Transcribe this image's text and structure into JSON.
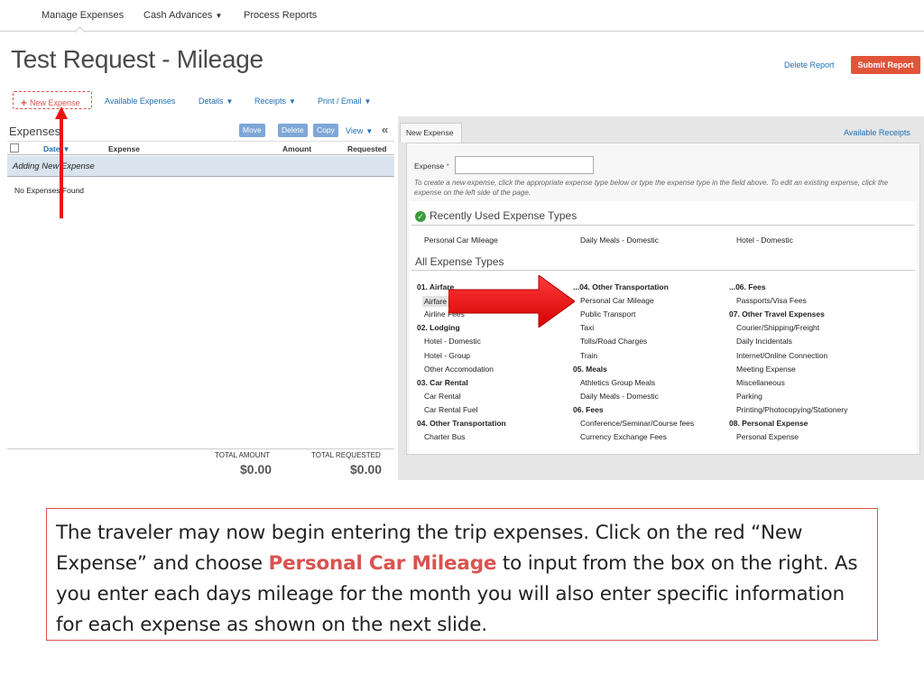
{
  "nav": {
    "items": [
      "Manage Expenses",
      "Cash Advances",
      "Process Reports"
    ],
    "caret": "▼"
  },
  "header": {
    "title": "Test Request - Mileage",
    "delete_report": "Delete Report",
    "submit_report": "Submit Report"
  },
  "toolbar": {
    "new_expense": "New Expense",
    "available_expenses": "Available Expenses",
    "details": "Details",
    "receipts": "Receipts",
    "print_email": "Print / Email"
  },
  "left": {
    "heading": "Expenses",
    "buttons": [
      "Move",
      "Delete",
      "Copy"
    ],
    "view": "View",
    "collapse_icon": "«",
    "columns": [
      "Date",
      "Expense",
      "Amount",
      "Requested"
    ],
    "adding_row": "Adding New Expense",
    "no_expenses": "No Expenses Found",
    "total_amount_label": "TOTAL AMOUNT",
    "total_amount": "$0.00",
    "total_requested_label": "TOTAL REQUESTED",
    "total_requested": "$0.00"
  },
  "right": {
    "tab": "New Expense",
    "available_receipts": "Available Receipts",
    "expense_label": "Expense",
    "required_mark": "*",
    "expense_value": "",
    "help_text": "To create a new expense, click the appropriate expense type below or type the expense type in the field above. To edit an existing expense, click the expense on the left side of the page.",
    "recent_title": "Recently Used Expense Types",
    "recent": [
      "Personal Car Mileage",
      "Daily Meals - Domestic",
      "Hotel - Domestic"
    ],
    "all_title": "All Expense Types",
    "col1": [
      {
        "type": "cat",
        "text": "01. Airfare"
      },
      {
        "type": "item",
        "text": "Airfare",
        "hl": true
      },
      {
        "type": "item",
        "text": "Airline Fees"
      },
      {
        "type": "cat",
        "text": "02. Lodging"
      },
      {
        "type": "item",
        "text": "Hotel - Domestic"
      },
      {
        "type": "item",
        "text": "Hotel - Group"
      },
      {
        "type": "item",
        "text": "Other Accomodation"
      },
      {
        "type": "cat",
        "text": "03. Car Rental"
      },
      {
        "type": "item",
        "text": "Car Rental"
      },
      {
        "type": "item",
        "text": "Car Rental Fuel"
      },
      {
        "type": "cat",
        "text": "04. Other Transportation"
      },
      {
        "type": "item",
        "text": "Charter Bus"
      }
    ],
    "col2": [
      {
        "type": "cat",
        "text": "...04. Other Transportation"
      },
      {
        "type": "item",
        "text": "Personal Car Mileage"
      },
      {
        "type": "item",
        "text": "Public Transport"
      },
      {
        "type": "item",
        "text": "Taxi"
      },
      {
        "type": "item",
        "text": "Tolls/Road Charges"
      },
      {
        "type": "item",
        "text": "Train"
      },
      {
        "type": "cat",
        "text": "05. Meals"
      },
      {
        "type": "item",
        "text": "Athletics Group Meals"
      },
      {
        "type": "item",
        "text": "Daily Meals - Domestic"
      },
      {
        "type": "cat",
        "text": "06. Fees"
      },
      {
        "type": "item",
        "text": "Conference/Seminar/Course fees"
      },
      {
        "type": "item",
        "text": "Currency Exchange Fees"
      }
    ],
    "col3": [
      {
        "type": "cat",
        "text": "...06. Fees"
      },
      {
        "type": "item",
        "text": "Passports/Visa Fees"
      },
      {
        "type": "cat",
        "text": "07. Other Travel Expenses"
      },
      {
        "type": "item",
        "text": "Courier/Shipping/Freight"
      },
      {
        "type": "item",
        "text": "Daily Incidentals"
      },
      {
        "type": "item",
        "text": "Internet/Online Connection"
      },
      {
        "type": "item",
        "text": "Meeting Expense"
      },
      {
        "type": "item",
        "text": "Miscellaneous"
      },
      {
        "type": "item",
        "text": "Parking"
      },
      {
        "type": "item",
        "text": "Printing/Photocopying/Stationery"
      },
      {
        "type": "cat",
        "text": "08. Personal Expense"
      },
      {
        "type": "item",
        "text": "Personal Expense"
      }
    ]
  },
  "callout": {
    "before": "The traveler may now begin entering the trip expenses.  Click on the red “New Expense” and choose ",
    "emphasis": "Personal Car Mileage",
    "after": " to input from the box on the right.  As you enter each days mileage for the month you will also enter specific information for each expense as shown on the next slide."
  },
  "colors": {
    "accent_red": "#d9534f",
    "link_blue": "#1f6fb2",
    "submit_orange": "#e0553a",
    "annotation_red": "#ee1111"
  }
}
